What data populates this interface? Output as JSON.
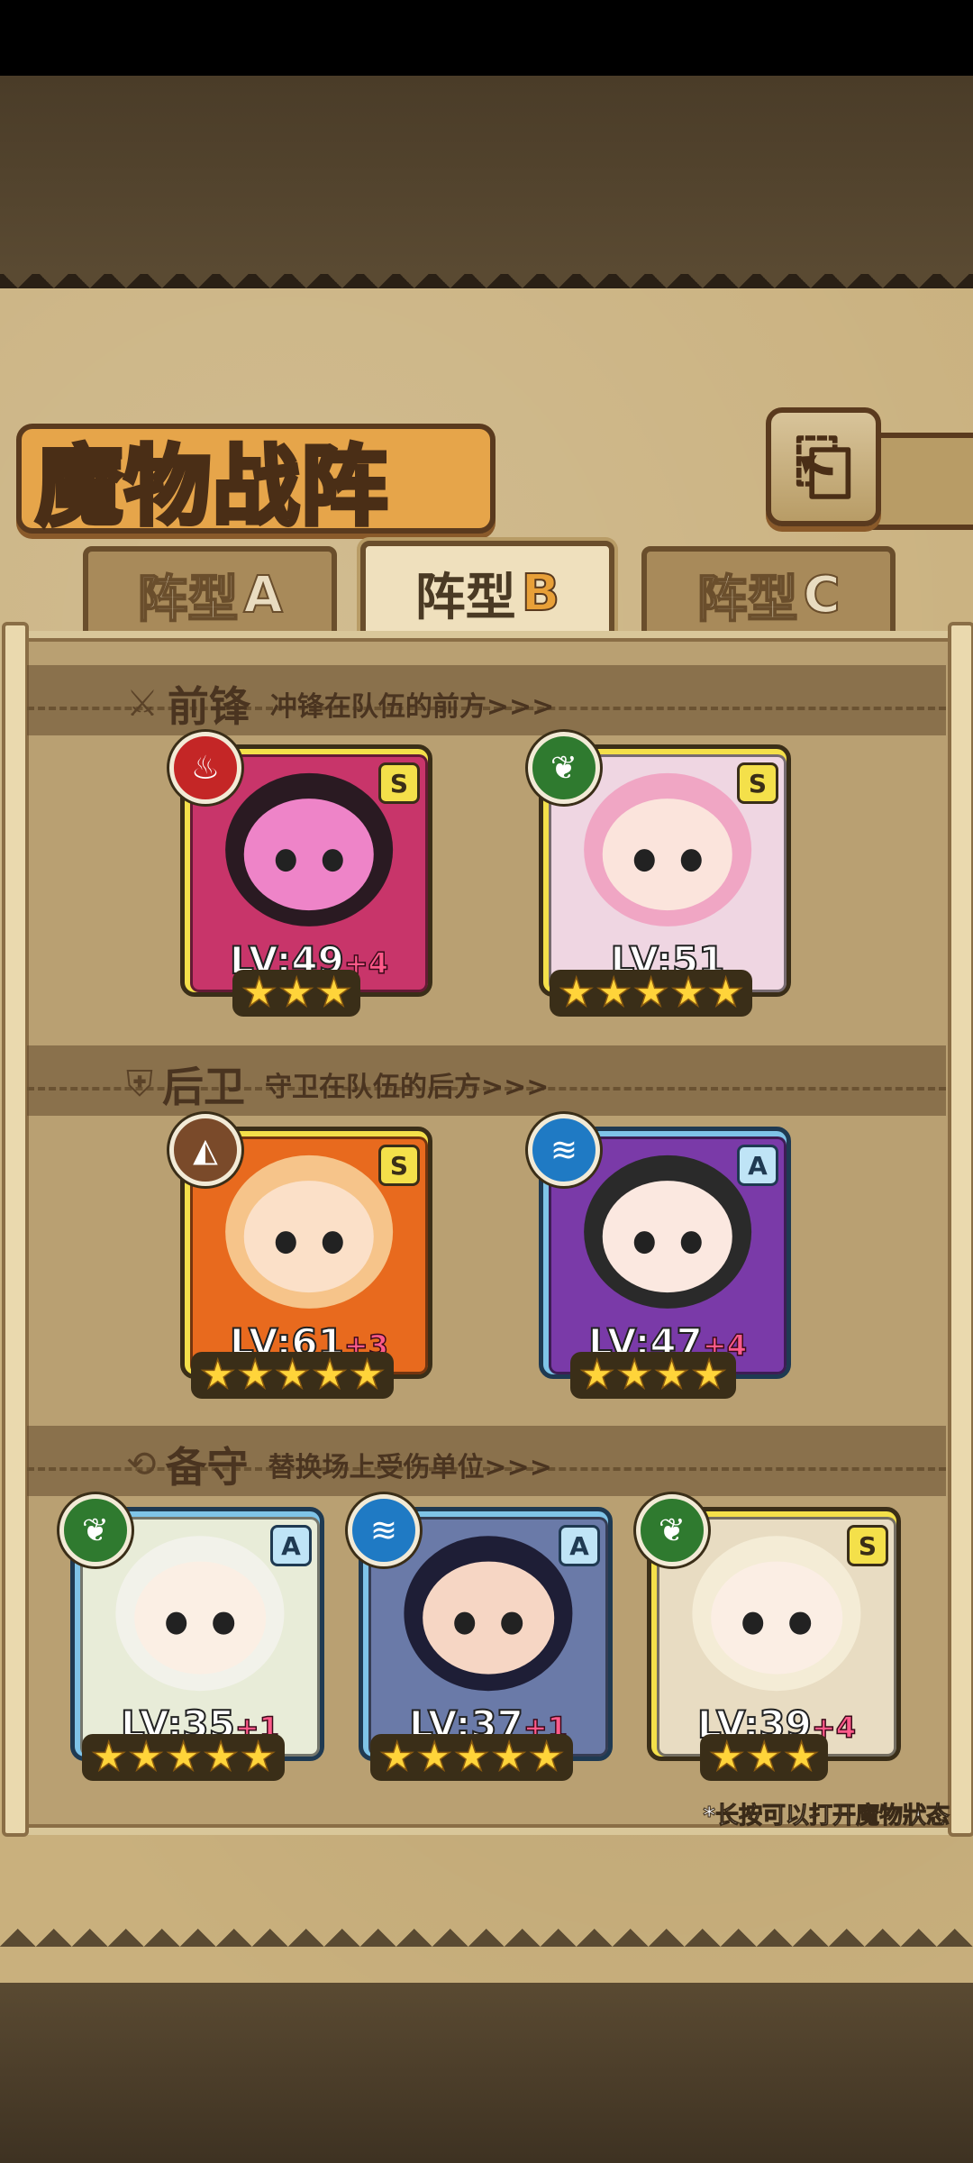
{
  "title": "魔物战阵",
  "back_icon": "back-arrow-icon",
  "tabs": [
    {
      "label": "阵型",
      "letter": "A",
      "active": false
    },
    {
      "label": "阵型",
      "letter": "B",
      "active": true
    },
    {
      "label": "阵型",
      "letter": "C",
      "active": false
    }
  ],
  "sections": {
    "front": {
      "title": "前锋",
      "subtitle": "冲锋在队伍的前方>>>",
      "icon": "sword-icon"
    },
    "back": {
      "title": "后卫",
      "subtitle": "守卫在队伍的后方>>>",
      "icon": "shield-icon"
    },
    "reserve": {
      "title": "备守",
      "subtitle": "替换场上受伤单位>>>",
      "icon": "swap-icon"
    }
  },
  "colors": {
    "fire": "#c42626",
    "leaf": "#2f7a2f",
    "earth": "#7a4a2a",
    "water": "#1f7ac4",
    "rank_S": "#f4e04a",
    "rank_A": "#7fc4e8"
  },
  "monsters": {
    "front": [
      {
        "rank": "S",
        "element": "fire-icon",
        "level": "LV:49",
        "plus": "+4",
        "stars": 3,
        "bg": "#c8356a",
        "skin": "#ee84c8",
        "hair": "#2a1a22"
      },
      {
        "rank": "S",
        "element": "leaf-icon",
        "level": "LV:51",
        "plus": "",
        "stars": 5,
        "bg": "#efd6e2",
        "skin": "#fbe4dc",
        "hair": "#f0a6c4"
      }
    ],
    "back": [
      {
        "rank": "S",
        "element": "earth-icon",
        "level": "LV:61",
        "plus": "+3",
        "stars": 5,
        "bg": "#e86a1e",
        "skin": "#fbe0c8",
        "hair": "#f6c48a"
      },
      {
        "rank": "A",
        "element": "water-icon",
        "level": "LV:47",
        "plus": "+4",
        "stars": 4,
        "bg": "#7a3aa8",
        "skin": "#fbe8e0",
        "hair": "#2a2a2a"
      }
    ],
    "reserve": [
      {
        "rank": "A",
        "element": "leaf-icon",
        "level": "LV:35",
        "plus": "+1",
        "stars": 5,
        "bg": "#e8ecd8",
        "skin": "#fbefe4",
        "hair": "#f2f2ea"
      },
      {
        "rank": "A",
        "element": "water-icon",
        "level": "LV:37",
        "plus": "+1",
        "stars": 5,
        "bg": "#6a7aa8",
        "skin": "#f6d6c4",
        "hair": "#1e1e36"
      },
      {
        "rank": "S",
        "element": "leaf-icon",
        "level": "LV:39",
        "plus": "+4",
        "stars": 3,
        "bg": "#e8dcc2",
        "skin": "#fbeee4",
        "hair": "#f4ecd6"
      }
    ]
  },
  "hint": "*长按可以打开魔物狀态"
}
